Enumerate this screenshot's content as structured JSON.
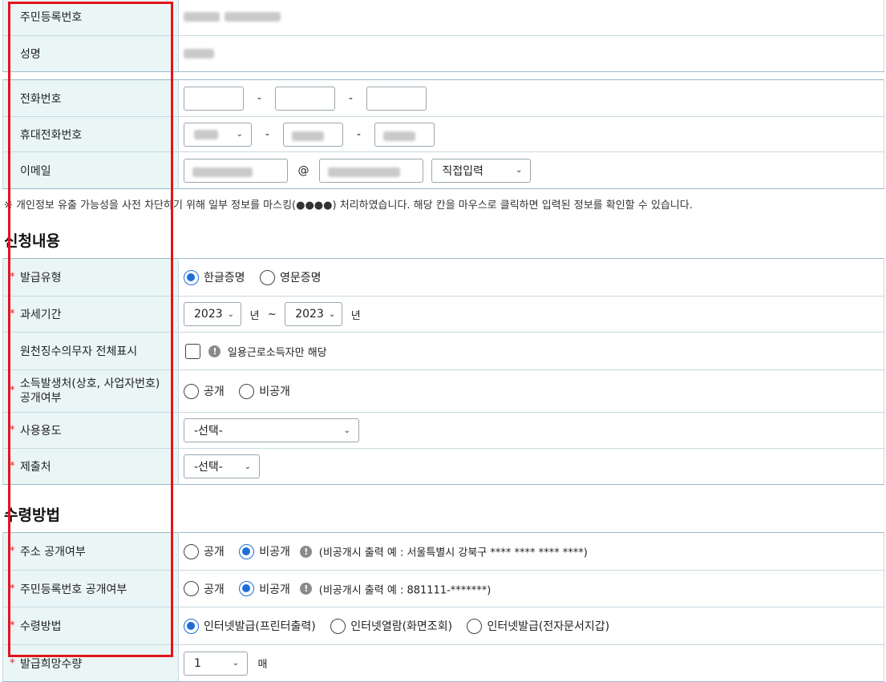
{
  "personal": {
    "rrn_label": "주민등록번호",
    "name_label": "성명"
  },
  "contact": {
    "phone_label": "전화번호",
    "mobile_label": "휴대전화번호",
    "email_label": "이메일",
    "at_sign": "@",
    "dash": "-",
    "email_domain_select": "직접입력"
  },
  "notice": "※ 개인정보 유출 가능성을 사전 차단하기 위해 일부 정보를 마스킹(●●●●) 처리하였습니다. 해당 칸을 마우스로 클릭하면 입력된 정보를 확인할 수 있습니다.",
  "application": {
    "title": "신청내용",
    "required_mark": "*",
    "issue_type_label": "발급유형",
    "issue_type_options": [
      "한글증명",
      "영문증명"
    ],
    "issue_type_selected": "한글증명",
    "tax_period_label": "과세기간",
    "tax_period_from": "2023",
    "tax_period_to": "2023",
    "year_unit": "년",
    "tilde": "~",
    "withholding_label": "원천징수의무자 전체표시",
    "withholding_note": "일용근로소득자만 해당",
    "income_source_label_1": "소득발생처(상호, 사업자번호)",
    "income_source_label_2": "공개여부",
    "income_source_options": [
      "공개",
      "비공개"
    ],
    "usage_label": "사용용도",
    "usage_select": "-선택-",
    "submit_to_label": "제출처",
    "submit_to_select": "-선택-"
  },
  "receipt": {
    "title": "수령방법",
    "address_label": "주소 공개여부",
    "address_options": [
      "공개",
      "비공개"
    ],
    "address_selected": "비공개",
    "address_note": "(비공개시 출력 예 : 서울특별시 강북구 **** **** **** ****)",
    "rrn_open_label": "주민등록번호 공개여부",
    "rrn_options": [
      "공개",
      "비공개"
    ],
    "rrn_selected": "비공개",
    "rrn_note": "(비공개시 출력 예 : 881111-*******)",
    "method_label": "수령방법",
    "method_options": [
      "인터넷발급(프린터출력)",
      "인터넷열람(화면조회)",
      "인터넷발급(전자문서지갑)"
    ],
    "method_selected": "인터넷발급(프린터출력)",
    "quantity_label": "발급희망수량",
    "quantity_value": "1",
    "quantity_unit": "매"
  },
  "colors": {
    "header_bg": "#eaf6f6",
    "required_star": "#d9212c",
    "radio_selected": "#1d6fd6",
    "highlight_box": "#e4141b"
  }
}
